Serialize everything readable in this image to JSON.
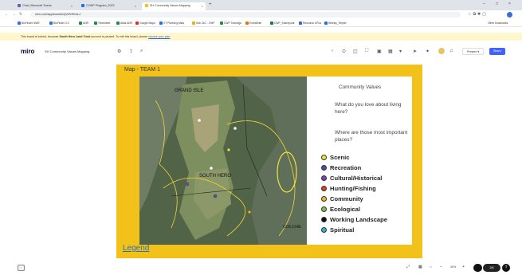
{
  "browser": {
    "tabs": [
      {
        "label": "Chat | Microsoft Teams",
        "color": "#6264a7",
        "active": false
      },
      {
        "label": "CVWP Program_2023",
        "color": "#1a73e8",
        "active": false
      },
      {
        "label": "SH Community Values Mapping",
        "color": "#f2c21a",
        "active": true
      }
    ],
    "url": "miro.com/app/board/uXjVMVRmIs=/",
    "bookmarks": [
      {
        "label": "BluFinder NWE",
        "color": "#2a6df4"
      },
      {
        "label": "BluFinder 3.0",
        "color": "#2a6df4"
      },
      {
        "label": "ANR",
        "color": "#1e8e3e"
      },
      {
        "label": "Timesheet",
        "color": "#1e8e3e"
      },
      {
        "label": "Atlas ANR",
        "color": "#1e8e3e"
      },
      {
        "label": "Google Maps",
        "color": "#d93025"
      },
      {
        "label": "VT Planning Atlas",
        "color": "#1a73e8"
      },
      {
        "label": "Sub 24C - CWP",
        "color": "#f9ab00"
      },
      {
        "label": "CWP Trainings",
        "color": "#1e8e3e"
      },
      {
        "label": "EventBrite",
        "color": "#e8710a"
      },
      {
        "label": "CWP_Sharepoint",
        "color": "#0b8043"
      },
      {
        "label": "Resource URLs",
        "color": "#3367d6"
      },
      {
        "label": "Weekly_Report",
        "color": "#1a73e8"
      }
    ],
    "other_bookmarks": "Other bookmarks"
  },
  "notice": {
    "pre": "This board is locked, because ",
    "org": "South Hero Land Trust",
    "mid": " account is paused. To edit this board, please ",
    "link": "choose your plan"
  },
  "miro": {
    "logo": "miro",
    "board_name": "SH Community Values Mapping",
    "present_label": "Present",
    "share_label": "Share",
    "zoom": "30%",
    "page_indicator": "2/8",
    "help": "?"
  },
  "frame": {
    "title": "Map - TEAM 1",
    "legend_link": "Legend",
    "map_labels": [
      "GRAND ISLE",
      "SOUTH HERO",
      "COLCHE"
    ]
  },
  "card": {
    "heading": "Community Values",
    "q1": "What do you love about living here?",
    "q2": "Where are those most important places?",
    "legend": [
      {
        "label": "Scenic",
        "color": "#f2e33a"
      },
      {
        "label": "Recreation",
        "color": "#4a4f9e"
      },
      {
        "label": "Cultural/Historical",
        "color": "#7c3fb8"
      },
      {
        "label": "Hunting/Fishing",
        "color": "#d6402a"
      },
      {
        "label": "Community",
        "color": "#f0b327"
      },
      {
        "label": "Ecological",
        "color": "#7cc24a"
      },
      {
        "label": "Working Landscape",
        "color": "#111111"
      },
      {
        "label": "Spiritual",
        "color": "#28b7c9"
      }
    ]
  }
}
